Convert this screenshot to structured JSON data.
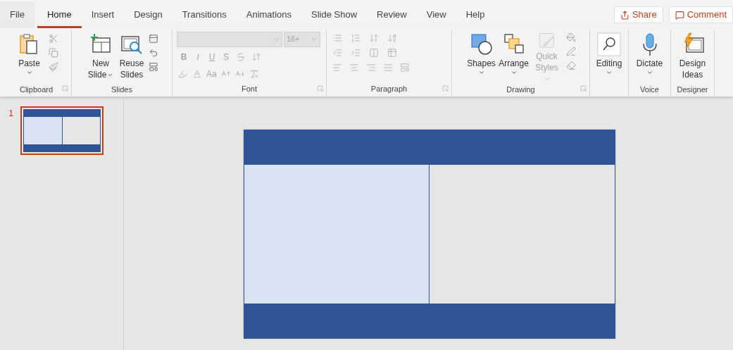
{
  "tabs": [
    {
      "label": "File",
      "selected": false
    },
    {
      "label": "Home",
      "selected": true
    },
    {
      "label": "Insert",
      "selected": false
    },
    {
      "label": "Design",
      "selected": false
    },
    {
      "label": "Transitions",
      "selected": false
    },
    {
      "label": "Animations",
      "selected": false
    },
    {
      "label": "Slide Show",
      "selected": false
    },
    {
      "label": "Review",
      "selected": false
    },
    {
      "label": "View",
      "selected": false
    },
    {
      "label": "Help",
      "selected": false
    }
  ],
  "actions": [
    {
      "label": "Share",
      "kind": "share"
    },
    {
      "label": "Comment",
      "kind": "comment"
    }
  ],
  "ribbon": {
    "groups": [
      {
        "name": "Clipboard",
        "kind": "clipboard",
        "launcher": true,
        "buttons": [
          {
            "label": "Paste",
            "kind": "paste",
            "dropdown": true,
            "disabled": false
          }
        ]
      },
      {
        "name": "Slides",
        "kind": "slides",
        "launcher": false,
        "buttons": [
          {
            "label": "New Slide",
            "kind": "new-slide",
            "dropdown": true,
            "disabled": false
          },
          {
            "label": "Reuse Slides",
            "kind": "reuse",
            "dropdown": false,
            "disabled": false
          }
        ]
      },
      {
        "name": "Font",
        "kind": "font",
        "launcher": true,
        "disabled": true,
        "font_size": "16+",
        "styles": [
          "B",
          "I",
          "U",
          "S"
        ],
        "case_label": "Aa"
      },
      {
        "name": "Paragraph",
        "kind": "paragraph",
        "launcher": true,
        "disabled": true
      },
      {
        "name": "Drawing",
        "kind": "drawing",
        "launcher": true,
        "buttons": [
          {
            "label": "Shapes",
            "kind": "shapes",
            "dropdown": true,
            "disabled": false
          },
          {
            "label": "Arrange",
            "kind": "arrange",
            "dropdown": true,
            "disabled": false
          },
          {
            "label": "Quick Styles",
            "kind": "quick-styles",
            "dropdown": true,
            "disabled": true
          }
        ]
      },
      {
        "kind": "editing",
        "launcher": false,
        "buttons": [
          {
            "label": "Editing",
            "kind": "editing",
            "dropdown": true,
            "disabled": false
          }
        ]
      },
      {
        "name": "Voice",
        "kind": "voice",
        "launcher": false,
        "buttons": [
          {
            "label": "Dictate",
            "kind": "dictate",
            "dropdown": true,
            "disabled": false
          }
        ]
      },
      {
        "name": "Designer",
        "kind": "designer",
        "launcher": false,
        "buttons": [
          {
            "label": "Design Ideas",
            "kind": "design-ideas",
            "dropdown": false,
            "disabled": false
          }
        ]
      }
    ]
  },
  "thumbnails": [
    {
      "number": "1",
      "selected": true
    }
  ],
  "slide": {
    "kind": "two-column",
    "panels": [
      {
        "color": "#dae3f3"
      },
      {
        "color": "#e7e6e6"
      }
    ]
  }
}
